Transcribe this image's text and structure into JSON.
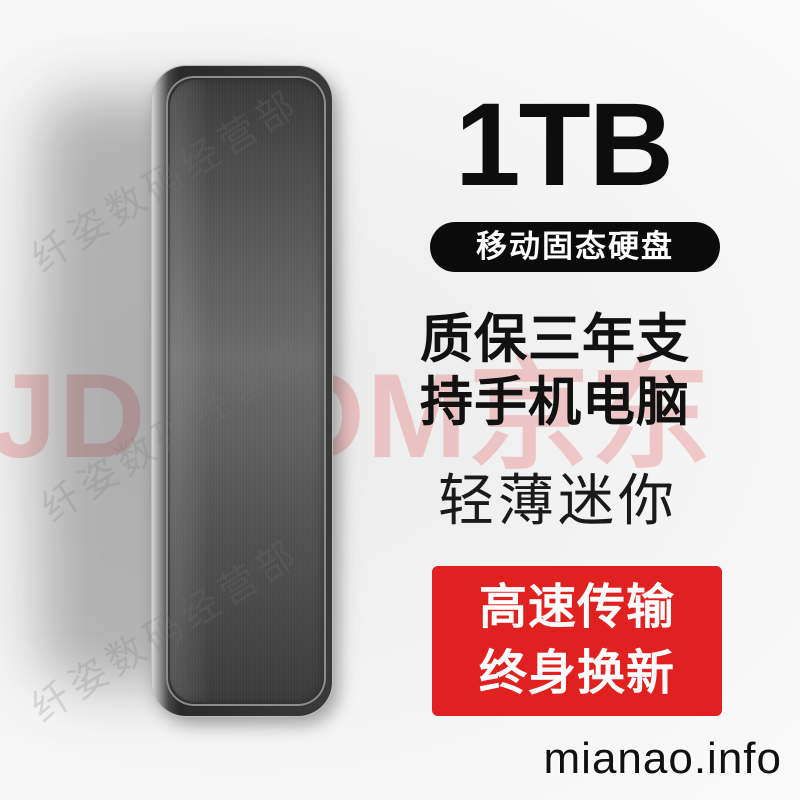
{
  "product": {
    "capacity": "1TB",
    "category_label": "移动固态硬盘",
    "feature_line_1": "质保三年支",
    "feature_line_2": "持手机电脑",
    "sub_feature": "轻薄迷你",
    "badge_line_1": "高速传输",
    "badge_line_2": "终身换新"
  },
  "watermarks": {
    "text_1": "纤姿数码经营部",
    "text_2": "纤姿数码经营部",
    "text_3": "纤姿数码经营部",
    "big_text": "JD.COM京东",
    "footer": "mianao.info"
  },
  "colors": {
    "accent_red": "#e0211f",
    "pill_black": "#0b0b0b",
    "text_dark": "#0d0d0d"
  }
}
